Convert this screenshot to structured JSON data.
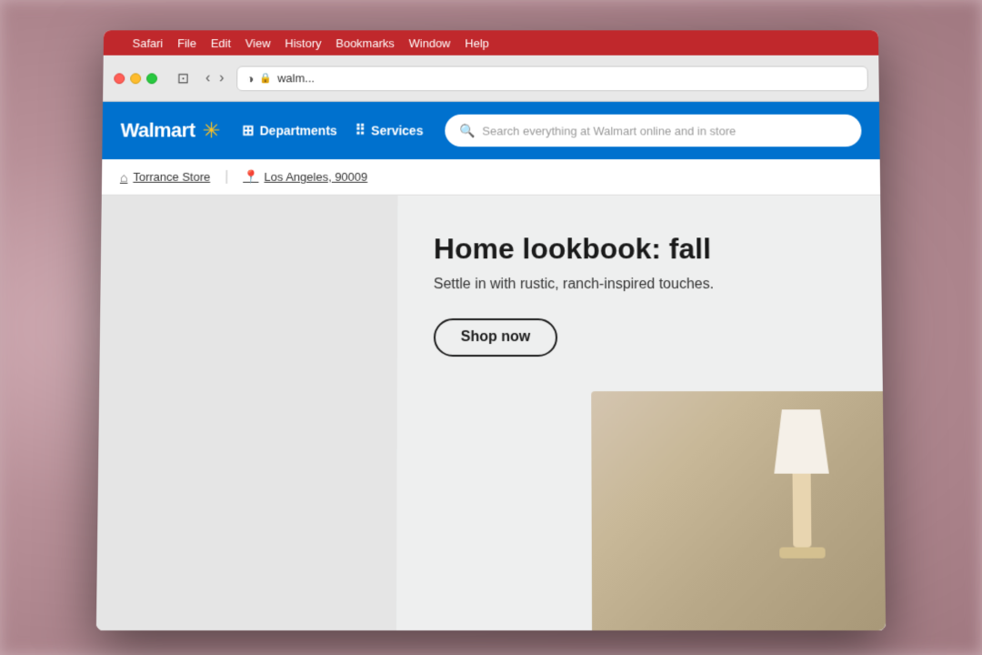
{
  "macos": {
    "menu_items": [
      "Safari",
      "File",
      "Edit",
      "View",
      "History",
      "Bookmarks",
      "Window",
      "Help"
    ],
    "apple_symbol": ""
  },
  "safari": {
    "address_bar": {
      "lock_icon": "🔒",
      "url_text": "walm...",
      "reader_icon": "◑"
    },
    "back_arrow": "‹",
    "forward_arrow": "›",
    "sidebar_icon": "⊡"
  },
  "walmart": {
    "logo": {
      "wordmark": "Walmart",
      "spark": "✳"
    },
    "nav": {
      "departments_label": "Departments",
      "services_label": "Services"
    },
    "search": {
      "placeholder": "Search everything at Walmart online and in store"
    },
    "location": {
      "store_icon": "⌂",
      "store_label": "Torrance Store",
      "pin_icon": "📍",
      "location_label": "Los Angeles, 90009"
    }
  },
  "hero": {
    "title": "Home lookbook: fall",
    "subtitle": "Settle in with rustic, ranch-inspired touches.",
    "cta_label": "Shop now"
  }
}
